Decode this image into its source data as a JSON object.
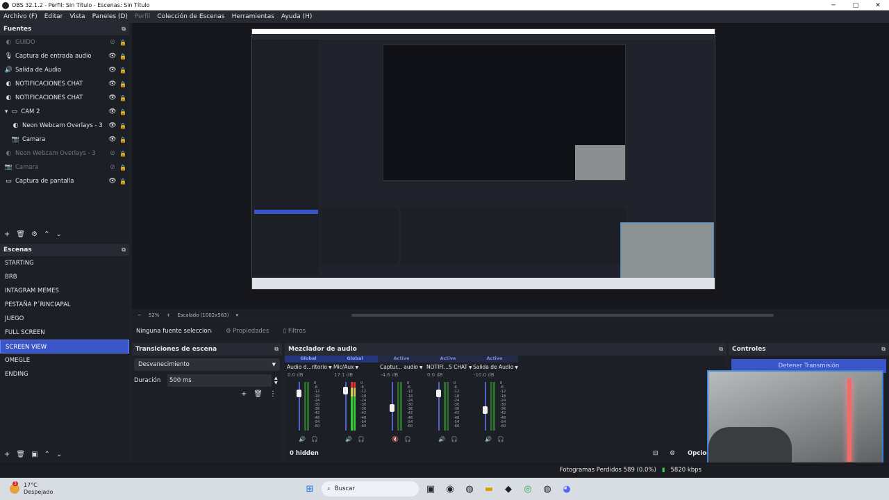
{
  "window": {
    "title": "OBS 32.1.2 - Perfil: Sin Título - Escenas: Sin Título"
  },
  "menu": [
    "Archivo (F)",
    "Editar",
    "Vista",
    "Paneles (D)",
    "Perfil",
    "Colección de Escenas",
    "Herramientas",
    "Ayuda (H)"
  ],
  "sources": {
    "title": "Fuentes",
    "items": [
      {
        "label": "GUIDO",
        "icon": "globe-icon",
        "visible": false
      },
      {
        "label": "Captura de entrada audio",
        "icon": "mic-icon",
        "visible": true
      },
      {
        "label": "Salida de Audio",
        "icon": "speaker-icon",
        "visible": true
      },
      {
        "label": "NOTIFICACIONES CHAT",
        "icon": "globe-icon",
        "visible": true
      },
      {
        "label": "NOTIFICACIONES CHAT",
        "icon": "globe-icon",
        "visible": true
      },
      {
        "label": "CAM 2",
        "icon": "folder-icon",
        "visible": true
      },
      {
        "label": "Neon Webcam Overlays - 3",
        "icon": "globe-icon",
        "visible": true
      },
      {
        "label": "Camara",
        "icon": "camera-icon",
        "visible": true
      },
      {
        "label": "Neon Webcam Overlays - 3",
        "icon": "globe-icon",
        "visible": false
      },
      {
        "label": "Camara",
        "icon": "camera-icon",
        "visible": false
      },
      {
        "label": "Captura de pantalla",
        "icon": "monitor-icon",
        "visible": true
      }
    ]
  },
  "scenes": {
    "title": "Escenas",
    "items": [
      "STARTING",
      "BRB",
      "INTAGRAM MEMES",
      "PESTAÑA P´RINCIAPAL",
      "JUEGO",
      "FULL SCREEN",
      "SCREEN VIEW",
      "OMEGLE",
      "ENDING"
    ],
    "selected": "SCREEN VIEW"
  },
  "zoom": {
    "minus": "−",
    "value": "52%",
    "plus": "+",
    "scale": "Escalado (1002x563)"
  },
  "props": {
    "no_selection": "Ninguna fuente seleccionad",
    "properties": "Propiedades",
    "filters": "Filtros"
  },
  "transitions": {
    "title": "Transiciones de escena",
    "selected": "Desvanecimiento",
    "duration_label": "Duración",
    "duration_value": "500 ms"
  },
  "mixer": {
    "title": "Mezclador de audio",
    "hidden": "0 hidden",
    "options": "Opcion",
    "channels": [
      {
        "state": "Global",
        "name": "Audio d...ritorio",
        "db": "0.0 dB",
        "level": 0.85
      },
      {
        "state": "Global",
        "name": "Mic/Aux",
        "db": "17.1 dB",
        "level": 0.9
      },
      {
        "state": "Active",
        "name": "Captur... audio",
        "db": "-4.6 dB",
        "level": 0.55
      },
      {
        "state": "Active",
        "name": "NOTIFI...S CHAT",
        "db": "0.0 dB",
        "level": 0.85
      },
      {
        "state": "Active",
        "name": "Salida de Audio",
        "db": "-10.0 dB",
        "level": 0.5
      }
    ],
    "ticks": [
      "0",
      "-6",
      "-12",
      "-18",
      "-24",
      "-30",
      "-36",
      "-42",
      "-48",
      "-54",
      "-60"
    ]
  },
  "controls": {
    "title": "Controles",
    "stop_stream": "Detener Transmisión"
  },
  "status": {
    "dropped": "Fotogramas Perdidos 589 (0.0%)",
    "bitrate": "5820 kbps"
  },
  "taskbar": {
    "temp": "17°C",
    "weather": "Despejado",
    "search": "Buscar",
    "badge": "3"
  }
}
